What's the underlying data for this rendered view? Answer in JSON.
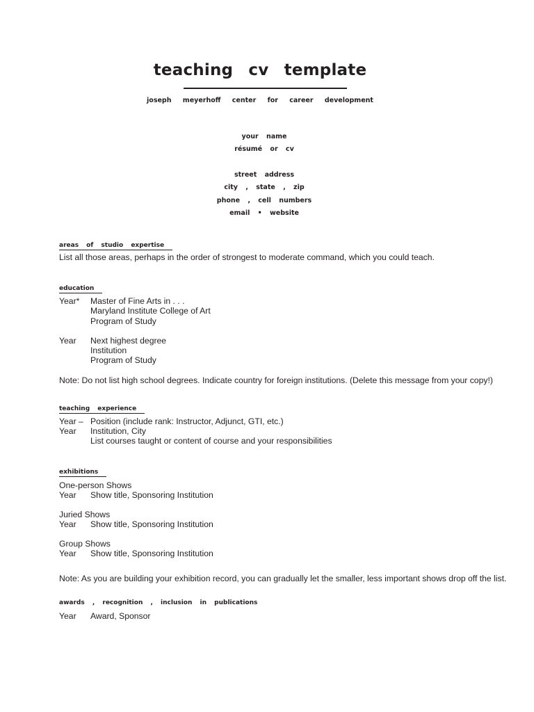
{
  "header": {
    "title": "teaching cv template",
    "subtitle": "joseph meyerhoff center for career development"
  },
  "contact": {
    "name": "your name",
    "doc_type": "résumé or cv",
    "street": "street address",
    "city_state_zip": "city , state , zip",
    "phone": "phone , cell numbers",
    "email": "email • website"
  },
  "sections": {
    "areas": {
      "heading": "areas of studio expertise",
      "text": "List all those areas, perhaps in the order of strongest to moderate command, which you could teach."
    },
    "education": {
      "heading": "education",
      "entries": [
        {
          "year": "Year*",
          "lines": [
            "Master of Fine Arts in . . .",
            "Maryland Institute College of Art",
            "Program of Study"
          ]
        },
        {
          "year": "Year",
          "lines": [
            "Next highest degree",
            "Institution",
            "Program of Study"
          ]
        }
      ],
      "note": "Note: Do not list high school degrees. Indicate country for foreign institutions. (Delete this message from your copy!)"
    },
    "teaching": {
      "heading": "teaching experience",
      "rows": [
        {
          "year": "Year –",
          "text": "Position (include rank: Instructor, Adjunct, GTI, etc.)"
        },
        {
          "year": "Year",
          "text": "Institution, City"
        },
        {
          "year": "",
          "text": "List courses taught or content of course and your responsibilities"
        }
      ]
    },
    "exhibitions": {
      "heading": "exhibitions",
      "groups": [
        {
          "label": "One-person Shows",
          "year": "Year",
          "text": "Show title, Sponsoring Institution"
        },
        {
          "label": "Juried Shows",
          "year": "Year",
          "text": "Show title, Sponsoring Institution"
        },
        {
          "label": "Group Shows",
          "year": "Year",
          "text": "Show title, Sponsoring Institution"
        }
      ],
      "note": "Note: As you are building your exhibition record, you can gradually let the smaller, less important shows drop off the list."
    },
    "awards": {
      "heading": "awards , recognition , inclusion in publications",
      "year": "Year",
      "text": "Award, Sponsor"
    }
  }
}
